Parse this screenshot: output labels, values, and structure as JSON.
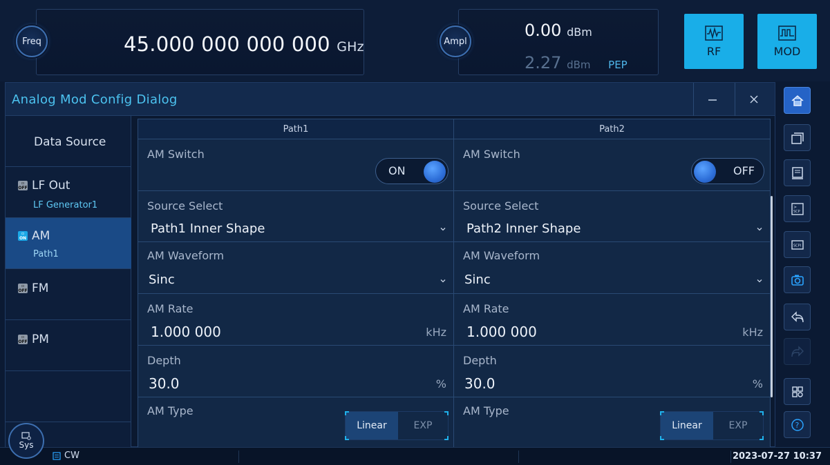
{
  "header": {
    "freq_label": "Freq",
    "freq_value": "45.000 000 000 000",
    "freq_unit": "GHz",
    "ampl_label": "Ampl",
    "ampl_value": "0.00",
    "ampl_unit": "dBm",
    "ampl_pep_value": "2.27",
    "ampl_pep_unit": "dBm",
    "ampl_pep_label": "PEP",
    "rf_label": "RF",
    "mod_label": "MOD"
  },
  "dialog": {
    "title": "Analog Mod Config Dialog",
    "nav": [
      {
        "title": "Data Source",
        "sub": ""
      },
      {
        "title": "LF Out",
        "sub": "LF Generator1",
        "state": "OFF"
      },
      {
        "title": "AM",
        "sub": "Path1",
        "state": "ON"
      },
      {
        "title": "FM",
        "sub": "",
        "state": "OFF"
      },
      {
        "title": "PM",
        "sub": "",
        "state": "OFF"
      }
    ],
    "path1": {
      "header": "Path1",
      "am_switch_label": "AM Switch",
      "am_switch_value": "ON",
      "source_label": "Source Select",
      "source_value": "Path1 Inner Shape",
      "waveform_label": "AM Waveform",
      "waveform_value": "Sinc",
      "rate_label": "AM Rate",
      "rate_value": "1.000 000",
      "rate_unit": "kHz",
      "depth_label": "Depth",
      "depth_value": "30.0",
      "depth_unit": "%",
      "type_label": "AM Type",
      "type_opt1": "Linear",
      "type_opt2": "EXP"
    },
    "path2": {
      "header": "Path2",
      "am_switch_label": "AM Switch",
      "am_switch_value": "OFF",
      "source_label": "Source Select",
      "source_value": "Path2 Inner Shape",
      "waveform_label": "AM Waveform",
      "waveform_value": "Sinc",
      "rate_label": "AM Rate",
      "rate_value": "1.000 000",
      "rate_unit": "kHz",
      "depth_label": "Depth",
      "depth_value": "30.0",
      "depth_unit": "%",
      "type_label": "AM Type",
      "type_opt1": "Linear",
      "type_opt2": "EXP"
    }
  },
  "status": {
    "sys_label": "Sys",
    "mode": "CW",
    "datetime": "2023-07-27 10:37"
  },
  "icons": [
    "home-icon",
    "window-stack-icon",
    "document-icon",
    "scpi-recorder-icon",
    "scpi-icon",
    "camera-icon",
    "undo-icon",
    "redo-icon",
    "app-grid-icon",
    "help-icon"
  ]
}
